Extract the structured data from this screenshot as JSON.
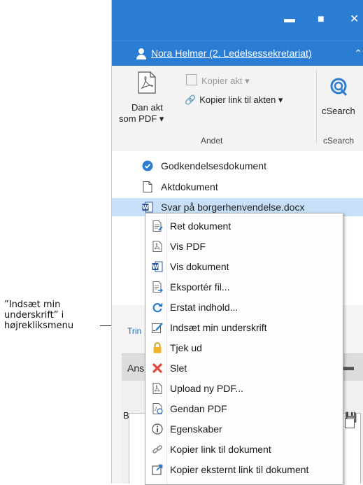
{
  "annotation": {
    "lines": [
      "”Indsæt min",
      "underskrift” i",
      "højrekliksmenu"
    ]
  },
  "window": {
    "controls": [
      "minimize",
      "maximize",
      "close"
    ],
    "user_name": "Nora Helmer (2. Ledelsessekretariat)",
    "accent_color": "#2b7cd3"
  },
  "ribbon": {
    "dan_akt_line1": "Dan akt",
    "dan_akt_line2": "som PDF ▾",
    "kopier_akt": "Kopier akt ▾",
    "kopier_link": "Kopier link til akten ▾",
    "group_andet": "Andet",
    "csearch_button": "cSearch",
    "group_csearch": "cSearch"
  },
  "documents": [
    {
      "label": "Godkendelsesdokument",
      "icon": "check-circle-icon"
    },
    {
      "label": "Aktdokument",
      "icon": "document-icon"
    },
    {
      "label": "Svar på borgerhenvendelse.docx",
      "icon": "word-icon",
      "selected": true
    }
  ],
  "background": {
    "trin": "Trin",
    "ans": "Ans",
    "ber": "Ber"
  },
  "context_menu": {
    "items": [
      {
        "label": "Ret dokument",
        "icon": "edit-document-icon"
      },
      {
        "label": "Vis PDF",
        "icon": "pdf-icon"
      },
      {
        "label": "Vis dokument",
        "icon": "word-icon"
      },
      {
        "label": "Eksportér fil...",
        "icon": "export-icon"
      },
      {
        "label": "Erstat indhold...",
        "icon": "refresh-icon"
      },
      {
        "label": "Indsæt min underskrift",
        "icon": "signature-icon"
      },
      {
        "label": "Tjek ud",
        "icon": "lock-icon"
      },
      {
        "label": "Slet",
        "icon": "delete-icon"
      },
      {
        "label": "Upload ny PDF...",
        "icon": "pdf-icon"
      },
      {
        "label": "Gendan PDF",
        "icon": "restore-pdf-icon"
      },
      {
        "label": "Egenskaber",
        "icon": "info-icon"
      },
      {
        "label": "Kopier link til dokument",
        "icon": "link-icon"
      },
      {
        "label": "Kopier eksternt link til dokument",
        "icon": "external-link-icon"
      }
    ]
  }
}
